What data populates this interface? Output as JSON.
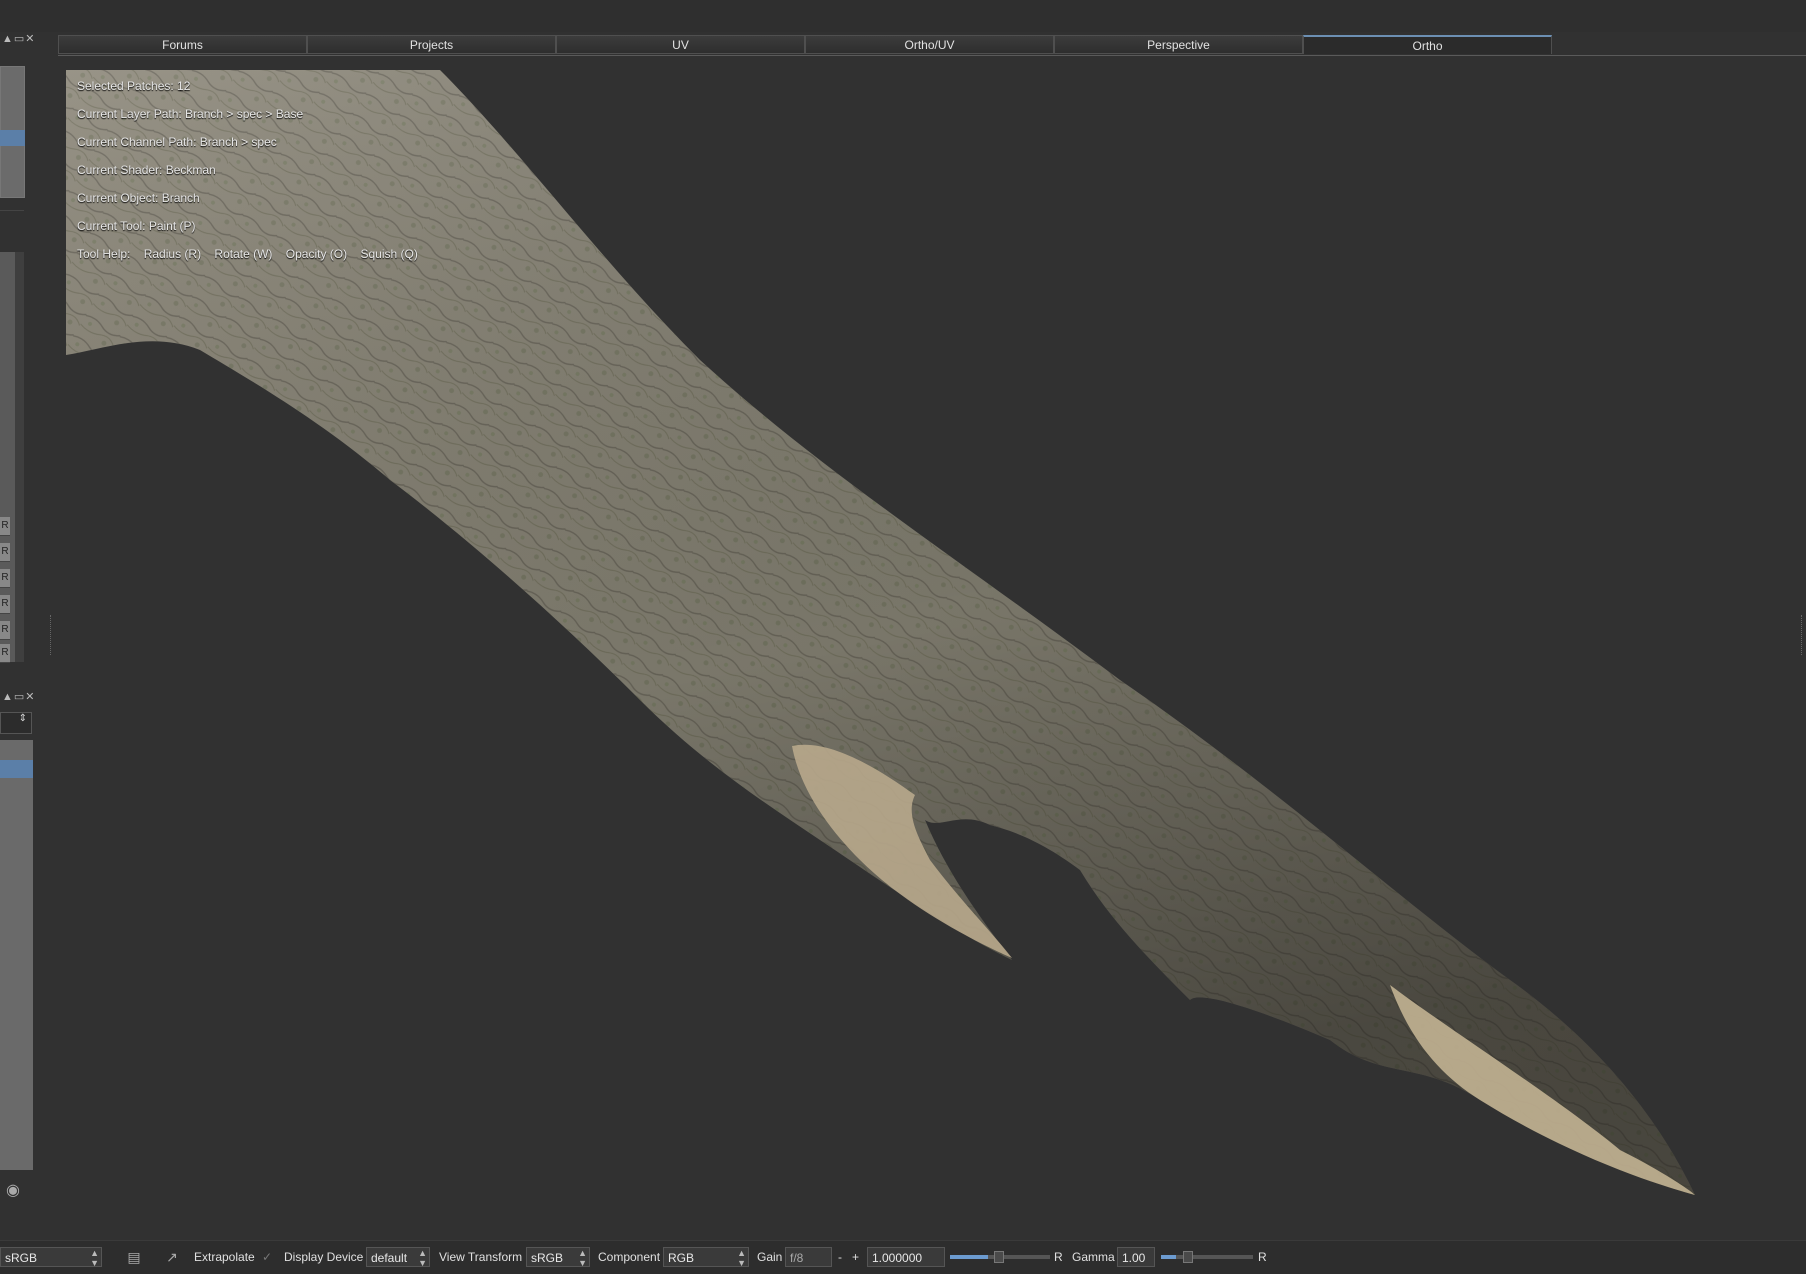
{
  "window": {
    "panel_controls": "▲▭✕"
  },
  "tabs": [
    {
      "label": "Forums"
    },
    {
      "label": "Projects"
    },
    {
      "label": "UV"
    },
    {
      "label": "Ortho/UV"
    },
    {
      "label": "Perspective"
    },
    {
      "label": "Ortho",
      "active": true
    }
  ],
  "viewport_info": {
    "selected_patches": "Selected Patches: 12",
    "layer_path": "Current Layer Path: Branch > spec > Base",
    "channel_path": "Current Channel Path: Branch > spec",
    "shader": "Current Shader: Beckman",
    "object": "Current Object: Branch",
    "tool": "Current Tool: Paint (P)",
    "tool_help_label": "Tool Help:",
    "tool_help_items": [
      "Radius (R)",
      "Rotate (W)",
      "Opacity (O)",
      "Squish (Q)"
    ]
  },
  "left_panel": {
    "row_letters": [
      "R",
      "R",
      "R",
      "R",
      "R",
      "R"
    ]
  },
  "bottom_bar": {
    "colorspace": "sRGB",
    "extrapolate_label": "Extrapolate",
    "display_device_label": "Display Device",
    "display_device_value": "default",
    "view_transform_label": "View Transform",
    "view_transform_value": "sRGB",
    "component_label": "Component",
    "component_value": "RGB",
    "gain_label": "Gain",
    "gain_fstop": "f/8",
    "gain_minus": "-",
    "gain_plus": "+",
    "gain_value": "1.000000",
    "gain_reset": "R",
    "gamma_label": "Gamma",
    "gamma_value": "1.00",
    "gamma_reset": "R"
  },
  "colors": {
    "background": "#313131",
    "accent": "#6c9bd0",
    "selection": "#5b7fa8"
  }
}
